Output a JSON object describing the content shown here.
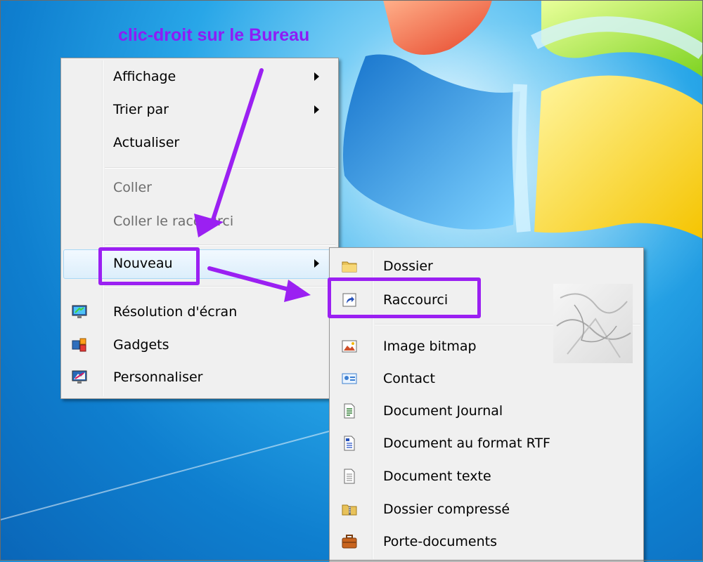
{
  "caption": "clic-droit sur le Bureau",
  "colors": {
    "accent": "#9b20f2",
    "menu_background": "#f0f0f0",
    "desktop_blue": "#1e8fd8"
  },
  "context_menu": {
    "items": [
      {
        "label": "Affichage",
        "submenu": true,
        "enabled": true
      },
      {
        "label": "Trier par",
        "submenu": true,
        "enabled": true
      },
      {
        "label": "Actualiser",
        "submenu": false,
        "enabled": true
      },
      {
        "label": "Coller",
        "submenu": false,
        "enabled": false
      },
      {
        "label": "Coller le raccourci",
        "submenu": false,
        "enabled": false
      },
      {
        "label": "Nouveau",
        "submenu": true,
        "enabled": true,
        "highlighted": true
      },
      {
        "label": "Résolution d'écran",
        "submenu": false,
        "enabled": true,
        "icon": "screen-resolution-icon"
      },
      {
        "label": "Gadgets",
        "submenu": false,
        "enabled": true,
        "icon": "gadgets-icon"
      },
      {
        "label": "Personnaliser",
        "submenu": false,
        "enabled": true,
        "icon": "personalize-icon"
      }
    ]
  },
  "new_submenu": {
    "items": [
      {
        "label": "Dossier",
        "icon": "folder-icon"
      },
      {
        "label": "Raccourci",
        "icon": "shortcut-icon"
      },
      {
        "label": "Image bitmap",
        "icon": "bitmap-image-icon"
      },
      {
        "label": "Contact",
        "icon": "contact-card-icon"
      },
      {
        "label": "Document Journal",
        "icon": "journal-document-icon"
      },
      {
        "label": "Document au format RTF",
        "icon": "rtf-document-icon"
      },
      {
        "label": "Document texte",
        "icon": "text-document-icon"
      },
      {
        "label": "Dossier compressé",
        "icon": "zip-folder-icon"
      },
      {
        "label": "Porte-documents",
        "icon": "briefcase-icon"
      }
    ]
  }
}
